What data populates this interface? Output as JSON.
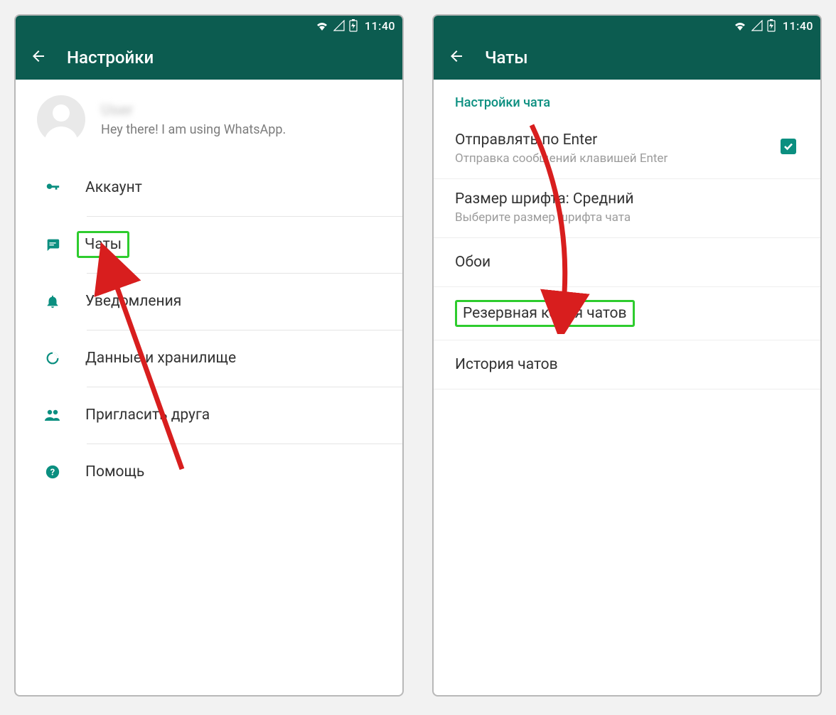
{
  "status_time": "11:40",
  "left": {
    "appbar_title": "Настройки",
    "profile": {
      "name": "User",
      "status": "Hey there! I am using WhatsApp."
    },
    "items": [
      {
        "label": "Аккаунт"
      },
      {
        "label": "Чаты"
      },
      {
        "label": "Уведомления"
      },
      {
        "label": "Данные и хранилище"
      },
      {
        "label": "Пригласить друга"
      },
      {
        "label": "Помощь"
      }
    ]
  },
  "right": {
    "appbar_title": "Чаты",
    "section_header": "Настройки чата",
    "items": [
      {
        "title": "Отправлять по Enter",
        "sub": "Отправка сообщений клавишей Enter",
        "checked": true
      },
      {
        "title": "Размер шрифта: Средний",
        "sub": "Выберите размер шрифта чата"
      },
      {
        "title": "Обои"
      },
      {
        "title": "Резервная копия чатов"
      },
      {
        "title": "История чатов"
      }
    ]
  }
}
